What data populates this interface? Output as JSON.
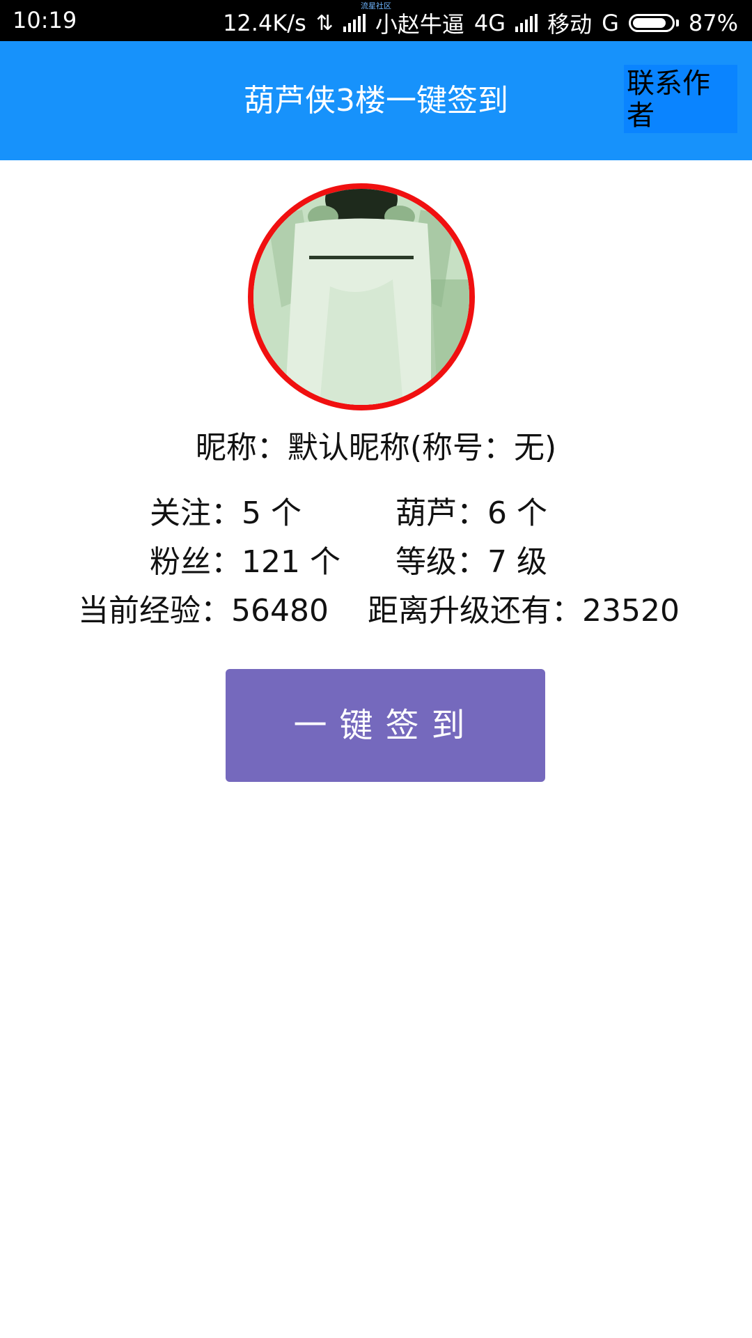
{
  "status_bar": {
    "time": "10:19",
    "watermark": "流星社区",
    "speed": "12.4K/s",
    "carrier1": "小赵牛逼",
    "network1": "4G",
    "carrier2": "移动",
    "network2": "G",
    "battery": "87%",
    "battery_level": 0.87
  },
  "header": {
    "title": "葫芦侠3楼一键签到",
    "contact_label": "联系作者"
  },
  "profile": {
    "nickname_line": "昵称：默认昵称(称号：无)",
    "follow": "关注：5 个",
    "gourd": "葫芦：6 个",
    "fans": "粉丝：121 个",
    "level": "等级：7 级",
    "exp": "当前经验：56480",
    "to_next": "距离升级还有：23520"
  },
  "actions": {
    "signin_label": "一键签到"
  },
  "colors": {
    "appbar": "#1792fb",
    "contact_bg": "#0a84ff",
    "button": "#7569bd",
    "avatar_border": "#f01010"
  }
}
